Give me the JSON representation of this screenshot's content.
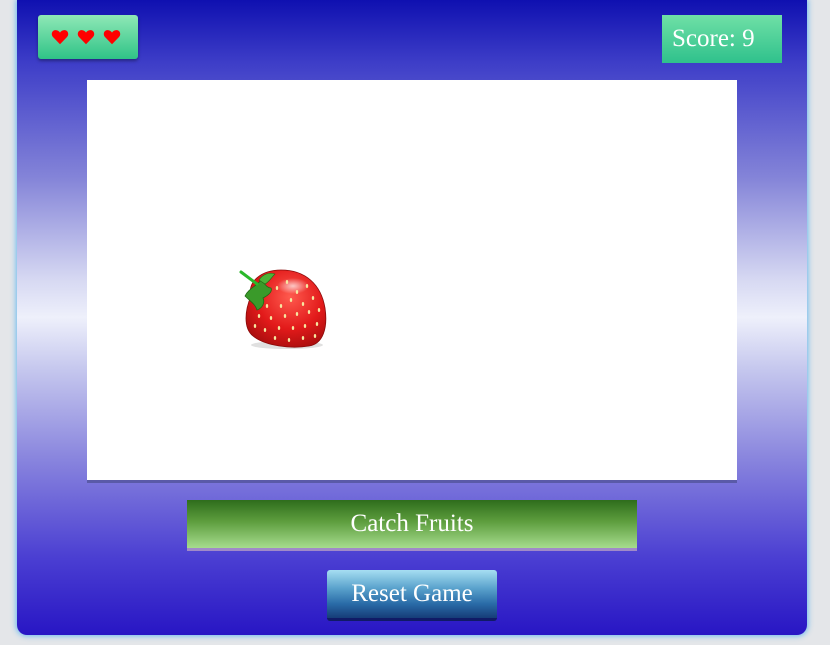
{
  "hud": {
    "lives": {
      "count": 3,
      "icon": "heart-icon",
      "color": "#ff0000"
    },
    "score_text": "Score: 9"
  },
  "game": {
    "fruit": {
      "type": "strawberry",
      "icon": "strawberry-icon"
    },
    "title": "Catch Fruits",
    "reset_label": "Reset Game"
  },
  "colors": {
    "frame_top": "#0f10b0",
    "frame_bottom": "#2816c4",
    "hud_green": "#2fc387",
    "title_green": "#2e6d1c",
    "reset_blue": "#2a6ca8"
  }
}
